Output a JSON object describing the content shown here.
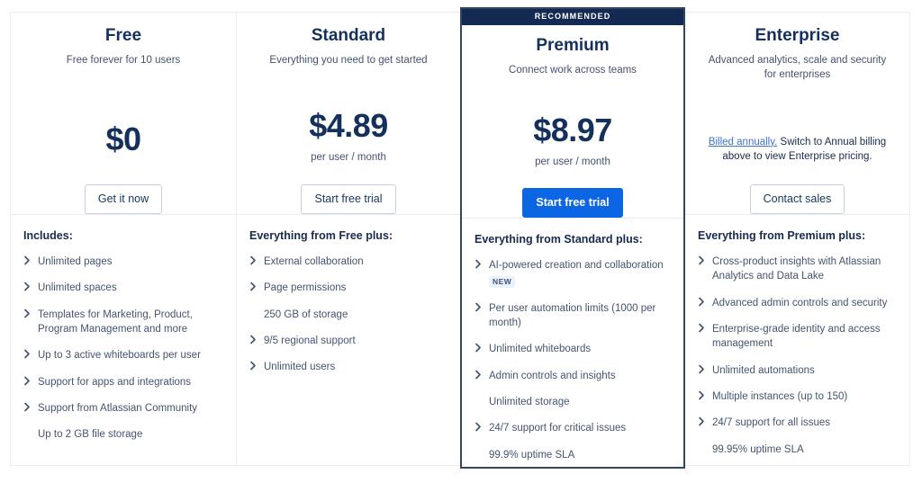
{
  "plans": [
    {
      "name": "Free",
      "tagline": "Free forever for 10 users",
      "price": "$0",
      "price_caption": "",
      "cta_label": "Get it now",
      "cta_style": "outline",
      "recommended": false,
      "badge_label": "",
      "features_title": "Includes:",
      "features": [
        {
          "text": "Unlimited pages",
          "icon": "chevron-right-icon",
          "has_icon": true,
          "badge": ""
        },
        {
          "text": "Unlimited spaces",
          "icon": "chevron-right-icon",
          "has_icon": true,
          "badge": ""
        },
        {
          "text": "Templates for Marketing, Product, Program Management and more",
          "icon": "chevron-right-icon",
          "has_icon": true,
          "badge": ""
        },
        {
          "text": "Up to 3 active whiteboards per user",
          "icon": "chevron-right-icon",
          "has_icon": true,
          "badge": ""
        },
        {
          "text": "Support for apps and integrations",
          "icon": "chevron-right-icon",
          "has_icon": true,
          "badge": ""
        },
        {
          "text": "Support from Atlassian Community",
          "icon": "chevron-right-icon",
          "has_icon": true,
          "badge": ""
        },
        {
          "text": "Up to 2 GB file storage",
          "icon": "",
          "has_icon": false,
          "badge": ""
        }
      ]
    },
    {
      "name": "Standard",
      "tagline": "Everything you need to get started",
      "price": "$4.89",
      "price_caption": "per user / month",
      "cta_label": "Start free trial",
      "cta_style": "outline",
      "recommended": false,
      "badge_label": "",
      "features_title": "Everything from Free plus:",
      "features": [
        {
          "text": "External collaboration",
          "icon": "chevron-right-icon",
          "has_icon": true,
          "badge": ""
        },
        {
          "text": "Page permissions",
          "icon": "chevron-right-icon",
          "has_icon": true,
          "badge": ""
        },
        {
          "text": "250 GB of storage",
          "icon": "",
          "has_icon": false,
          "badge": ""
        },
        {
          "text": "9/5 regional support",
          "icon": "chevron-right-icon",
          "has_icon": true,
          "badge": ""
        },
        {
          "text": "Unlimited users",
          "icon": "chevron-right-icon",
          "has_icon": true,
          "badge": ""
        }
      ]
    },
    {
      "name": "Premium",
      "tagline": "Connect work across teams",
      "price": "$8.97",
      "price_caption": "per user / month",
      "cta_label": "Start free trial",
      "cta_style": "primary",
      "recommended": true,
      "badge_label": "RECOMMENDED",
      "features_title": "Everything from Standard plus:",
      "features": [
        {
          "text": "AI-powered creation and collaboration",
          "icon": "chevron-right-icon",
          "has_icon": true,
          "badge": "NEW"
        },
        {
          "text": "Per user automation limits (1000 per month)",
          "icon": "chevron-right-icon",
          "has_icon": true,
          "badge": ""
        },
        {
          "text": "Unlimited whiteboards",
          "icon": "chevron-right-icon",
          "has_icon": true,
          "badge": ""
        },
        {
          "text": "Admin controls and insights",
          "icon": "chevron-right-icon",
          "has_icon": true,
          "badge": ""
        },
        {
          "text": "Unlimited storage",
          "icon": "",
          "has_icon": false,
          "badge": ""
        },
        {
          "text": "24/7 support for critical issues",
          "icon": "chevron-right-icon",
          "has_icon": true,
          "badge": ""
        },
        {
          "text": "99.9% uptime SLA",
          "icon": "",
          "has_icon": false,
          "badge": ""
        }
      ]
    },
    {
      "name": "Enterprise",
      "tagline": "Advanced analytics, scale and security for enterprises",
      "price": "",
      "price_caption": "",
      "billing_link": "Billed annually.",
      "billing_note": " Switch to Annual billing above to view Enterprise pricing.",
      "cta_label": "Contact sales",
      "cta_style": "outline",
      "recommended": false,
      "badge_label": "",
      "features_title": "Everything from Premium plus:",
      "features": [
        {
          "text": "Cross-product insights with Atlassian Analytics and Data Lake",
          "icon": "chevron-right-icon",
          "has_icon": true,
          "badge": ""
        },
        {
          "text": "Advanced admin controls and security",
          "icon": "chevron-right-icon",
          "has_icon": true,
          "badge": ""
        },
        {
          "text": "Enterprise-grade identity and access management",
          "icon": "chevron-right-icon",
          "has_icon": true,
          "badge": ""
        },
        {
          "text": "Unlimited automations",
          "icon": "chevron-right-icon",
          "has_icon": true,
          "badge": ""
        },
        {
          "text": "Multiple instances (up to 150)",
          "icon": "chevron-right-icon",
          "has_icon": true,
          "badge": ""
        },
        {
          "text": "24/7 support for all issues",
          "icon": "chevron-right-icon",
          "has_icon": true,
          "badge": ""
        },
        {
          "text": "99.95% uptime SLA",
          "icon": "",
          "has_icon": false,
          "badge": ""
        }
      ]
    }
  ],
  "colors": {
    "recommended_banner_bg": "#142A53",
    "primary_button_bg": "#0C66E4",
    "heading": "#14305C",
    "body_text": "#44546F",
    "link": "#3B73D1",
    "card_border": "#EBECF0",
    "highlight_border": "#344563",
    "badge_bg": "#E9F2FF"
  }
}
